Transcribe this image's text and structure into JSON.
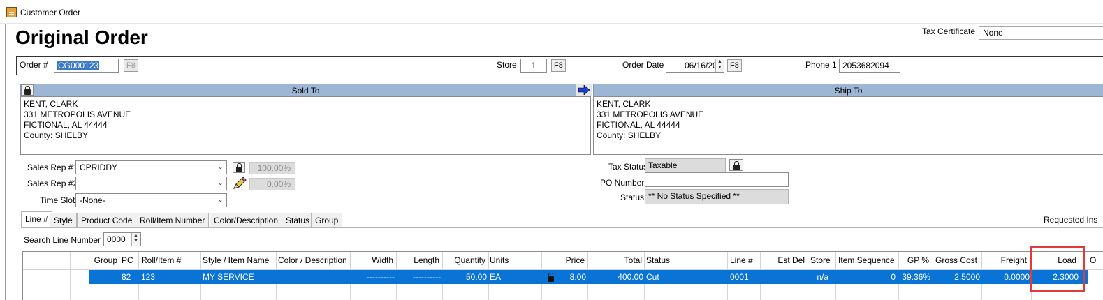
{
  "window": {
    "title": "Customer Order"
  },
  "header": {
    "title": "Original Order",
    "tax_certificate_label": "Tax Certificate",
    "tax_certificate_value": "None"
  },
  "order_bar": {
    "order_label": "Order #",
    "order_value": "CG000123",
    "order_f8": "F8",
    "store_label": "Store",
    "store_value": "1",
    "store_f8": "F8",
    "order_date_label": "Order Date",
    "order_date_value": "06/16/20",
    "date_f8": "F8",
    "phone_label": "Phone 1",
    "phone_value": "2053682094"
  },
  "sold_to": {
    "header": "Sold To",
    "lines": [
      "KENT, CLARK",
      "331 METROPOLIS AVENUE",
      "FICTIONAL, AL  44444",
      "County: SHELBY"
    ]
  },
  "ship_to": {
    "header": "Ship To",
    "lines": [
      "KENT, CLARK",
      "331 METROPOLIS AVENUE",
      "FICTIONAL, AL  44444",
      "County: SHELBY"
    ]
  },
  "sales": {
    "rep1_label": "Sales Rep #1",
    "rep1_value": "CPRIDDY",
    "rep1_pct": "100.00%",
    "rep2_label": "Sales Rep #2",
    "rep2_value": "",
    "rep2_pct": "0.00%",
    "timeslot_label": "Time Slot",
    "timeslot_value": "-None-"
  },
  "status_panel": {
    "tax_status_label": "Tax Status",
    "tax_status_value": "Taxable",
    "po_label": "PO Number",
    "po_value": "",
    "status_label": "Status",
    "status_value": "** No Status Specified **"
  },
  "tabs": [
    "Line #",
    "Style",
    "Product Code",
    "Roll/Item Number",
    "Color/Description",
    "Status",
    "Group"
  ],
  "requested_label": "Requested Ins",
  "search": {
    "label": "Search Line Number",
    "value": "0000"
  },
  "grid": {
    "headers": {
      "group": "Group",
      "pc": "PC",
      "roll": "Roll/Item #",
      "style": "Style / Item Name",
      "color": "Color / Description",
      "width": "Width",
      "length": "Length",
      "quantity": "Quantity",
      "units": "Units",
      "price": "Price",
      "total": "Total",
      "status": "Status",
      "line": "Line #",
      "estdel": "Est Del",
      "store": "Store",
      "itemseq": "Item Sequence",
      "gp": "GP %",
      "grosscost": "Gross Cost",
      "freight": "Freight",
      "load": "Load",
      "overflow": "O"
    },
    "row": {
      "group": "",
      "pc": "82",
      "roll": "123",
      "style": "MY SERVICE",
      "color": "",
      "width": "----------",
      "length": "----------",
      "quantity": "50.00",
      "units": "EA",
      "price": "8.00",
      "total": "400.00",
      "status": "Cut",
      "line": "0001",
      "estdel": "",
      "store": "n/a",
      "itemseq": "0",
      "gp": "39.36%",
      "grosscost": "2.5000",
      "freight": "0.0000",
      "load": "2.3000"
    }
  },
  "colors": {
    "selection": "#0a74d6",
    "section_header": "#9db6d6",
    "highlight": "#e03a3a"
  }
}
